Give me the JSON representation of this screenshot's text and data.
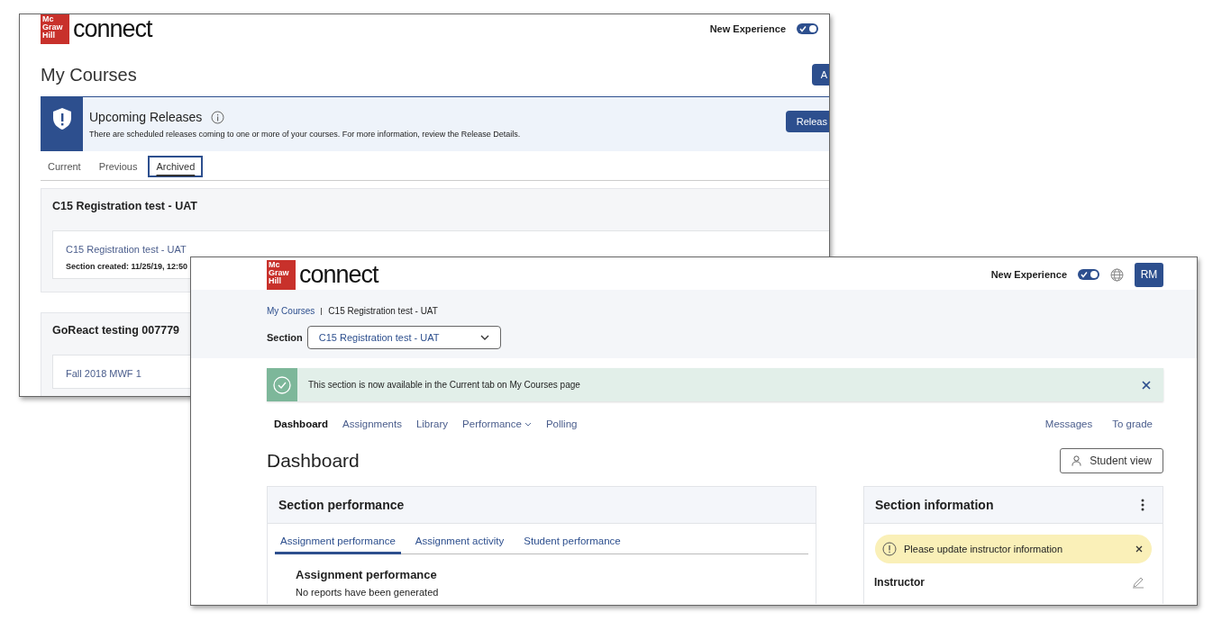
{
  "back_window": {
    "logo": "Mc Graw Hill",
    "app_name": "connect",
    "new_experience": {
      "label": "New Experience",
      "on": true
    },
    "title": "My Courses",
    "add_button": "A",
    "banner": {
      "title": "Upcoming Releases",
      "text": "There are scheduled releases coming to one or more of your courses. For more information, review the Release Details.",
      "button": "Releas"
    },
    "tabs": [
      {
        "label": "Current",
        "selected": false
      },
      {
        "label": "Previous",
        "selected": false
      },
      {
        "label": "Archived",
        "selected": true
      }
    ],
    "courses": [
      {
        "title": "C15 Registration test - UAT",
        "section": {
          "name": "C15 Registration test - UAT",
          "created": "Section created: 11/25/19, 12:50"
        }
      },
      {
        "title": "GoReact testing 007779",
        "section": {
          "name": "Fall 2018 MWF 1"
        }
      }
    ]
  },
  "front_window": {
    "logo": "Mc Graw Hill",
    "app_name": "connect",
    "new_experience": {
      "label": "New Experience",
      "on": true
    },
    "avatar": "RM",
    "breadcrumb": [
      {
        "label": "My Courses",
        "link": true
      },
      {
        "label": "C15 Registration test - UAT",
        "link": false
      }
    ],
    "section_select": {
      "label": "Section",
      "value": "C15 Registration test - UAT"
    },
    "alert": {
      "text": "This section is now available in the Current tab on My Courses page"
    },
    "nav": [
      {
        "label": "Dashboard",
        "selected": true,
        "menu": false
      },
      {
        "label": "Assignments",
        "selected": false,
        "menu": false
      },
      {
        "label": "Library",
        "selected": false,
        "menu": false
      },
      {
        "label": "Performance",
        "selected": false,
        "menu": true
      },
      {
        "label": "Polling",
        "selected": false,
        "menu": false
      }
    ],
    "nav_right": [
      "Messages",
      "To grade"
    ],
    "page_title": "Dashboard",
    "student_view_button": "Student view",
    "section_performance": {
      "title": "Section performance",
      "tabs": [
        {
          "label": "Assignment performance",
          "selected": true
        },
        {
          "label": "Assignment activity",
          "selected": false
        },
        {
          "label": "Student performance",
          "selected": false
        }
      ],
      "heading": "Assignment performance",
      "text": "No reports have been generated"
    },
    "section_information": {
      "title": "Section information",
      "warning": "Please update instructor information",
      "instructor_label": "Instructor"
    }
  }
}
